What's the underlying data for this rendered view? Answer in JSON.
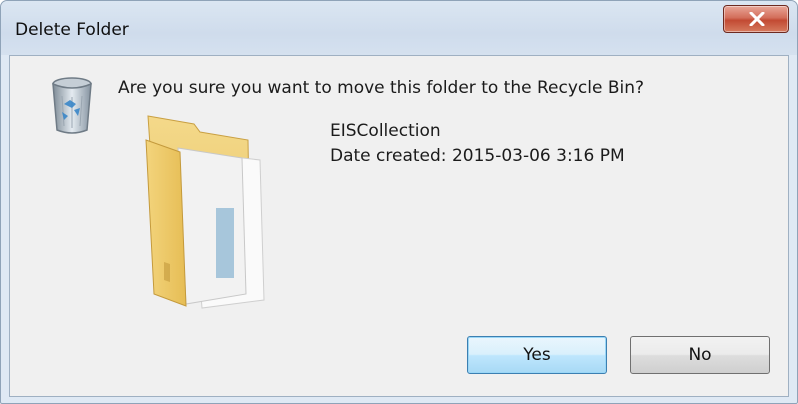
{
  "window": {
    "title": "Delete Folder",
    "close_icon": "close-x-icon"
  },
  "dialog": {
    "question": "Are you sure you want to move this folder to the Recycle Bin?",
    "recycle_icon": "recycle-bin-icon",
    "folder_icon": "folder-icon",
    "folder_name": "EISCollection",
    "date_label": "Date created:",
    "date_value": "2015-03-06 3:16 PM"
  },
  "buttons": {
    "yes_label": "Yes",
    "no_label": "No"
  },
  "colors": {
    "client_bg": "#f0f0f0",
    "close_button": "#c24a33",
    "default_button_border": "#3c7fb1"
  }
}
